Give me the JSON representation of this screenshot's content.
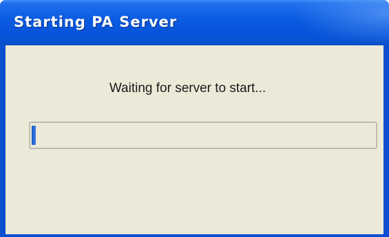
{
  "window": {
    "title": "Starting PA Server"
  },
  "dialog": {
    "message": "Waiting for server to start...",
    "progress_fraction": 0.012
  }
}
